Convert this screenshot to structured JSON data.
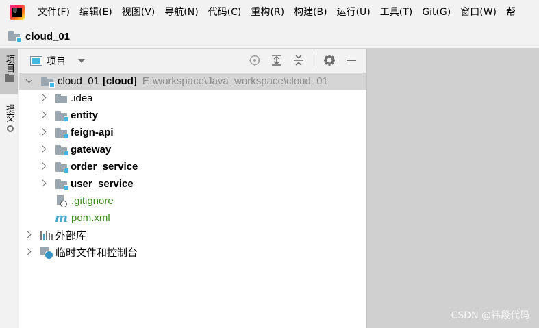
{
  "menubar": {
    "app_icon": "intellij-idea-icon",
    "items": [
      "文件(F)",
      "编辑(E)",
      "视图(V)",
      "导航(N)",
      "代码(C)",
      "重构(R)",
      "构建(B)",
      "运行(U)",
      "工具(T)",
      "Git(G)",
      "窗口(W)",
      "帮"
    ]
  },
  "navbar": {
    "project_name": "cloud_01"
  },
  "leftstrip": {
    "project_tab": "项目",
    "commit_tab": "提交"
  },
  "panel": {
    "title": "项目",
    "tools": [
      "locate-icon",
      "expand-all-icon",
      "collapse-all-icon",
      "gear-icon",
      "minimize-icon"
    ]
  },
  "tree": {
    "root": {
      "name": "cloud_01",
      "module": "[cloud]",
      "path": "E:\\workspace\\Java_workspace\\cloud_01"
    },
    "items": [
      {
        "label": ".idea"
      },
      {
        "label": "entity"
      },
      {
        "label": "feign-api"
      },
      {
        "label": "gateway"
      },
      {
        "label": "order_service"
      },
      {
        "label": "user_service"
      },
      {
        "label": ".gitignore"
      },
      {
        "label": "pom.xml"
      }
    ],
    "external_libraries": "外部库",
    "scratches": "临时文件和控制台"
  },
  "watermark": "CSDN @祎段代码",
  "colors": {
    "folder": "#9aa7b0",
    "module_marker": "#40b6e0",
    "vcs_added": "#3d8a1f",
    "selection": "#d5d5d5"
  }
}
